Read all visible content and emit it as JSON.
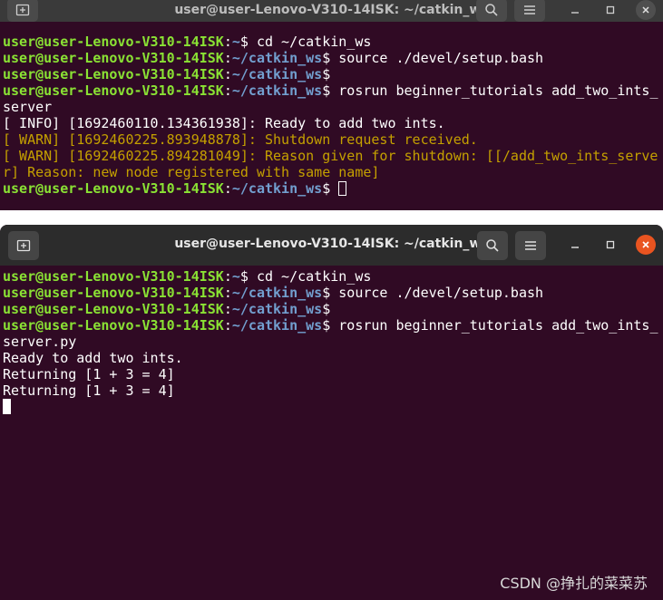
{
  "windows": [
    {
      "title": "user@user-Lenovo-V310-14ISK: ~/catkin_ws",
      "lines": [
        {
          "user": "user@user-Lenovo-V310-14ISK",
          "path": "~",
          "cmd": " cd ~/catkin_ws"
        },
        {
          "user": "user@user-Lenovo-V310-14ISK",
          "path": "~/catkin_ws",
          "cmd": " source ./devel/setup.bash"
        },
        {
          "user": "user@user-Lenovo-V310-14ISK",
          "path": "~/catkin_ws",
          "cmd": ""
        },
        {
          "user": "user@user-Lenovo-V310-14ISK",
          "path": "~/catkin_ws",
          "cmd": " rosrun beginner_tutorials add_two_ints_server"
        },
        {
          "text": "[ INFO] [1692460110.134361938]: Ready to add two ints."
        },
        {
          "warn": "[ WARN] [1692460225.893948878]: Shutdown request received."
        },
        {
          "warn": "[ WARN] [1692460225.894281049]: Reason given for shutdown: [[/add_two_ints_server] Reason: new node registered with same name]"
        },
        {
          "user": "user@user-Lenovo-V310-14ISK",
          "path": "~/catkin_ws",
          "cmd": " ",
          "cursor": "empty"
        }
      ]
    },
    {
      "title": "user@user-Lenovo-V310-14ISK: ~/catkin_ws",
      "lines": [
        {
          "user": "user@user-Lenovo-V310-14ISK",
          "path": "~",
          "cmd": " cd ~/catkin_ws"
        },
        {
          "user": "user@user-Lenovo-V310-14ISK",
          "path": "~/catkin_ws",
          "cmd": " source ./devel/setup.bash"
        },
        {
          "user": "user@user-Lenovo-V310-14ISK",
          "path": "~/catkin_ws",
          "cmd": ""
        },
        {
          "user": "user@user-Lenovo-V310-14ISK",
          "path": "~/catkin_ws",
          "cmd": " rosrun beginner_tutorials add_two_ints_server.py"
        },
        {
          "text": "Ready to add two ints."
        },
        {
          "text": "Returning [1 + 3 = 4]"
        },
        {
          "text": "Returning [1 + 3 = 4]"
        },
        {
          "text": "",
          "cursor": "full"
        }
      ]
    }
  ],
  "watermark": "CSDN @挣扎的菜菜苏",
  "colors": {
    "user": "#8ae234",
    "path": "#729fcf",
    "warn": "#c4a000",
    "bg": "#300a24",
    "close": "#e95420"
  }
}
